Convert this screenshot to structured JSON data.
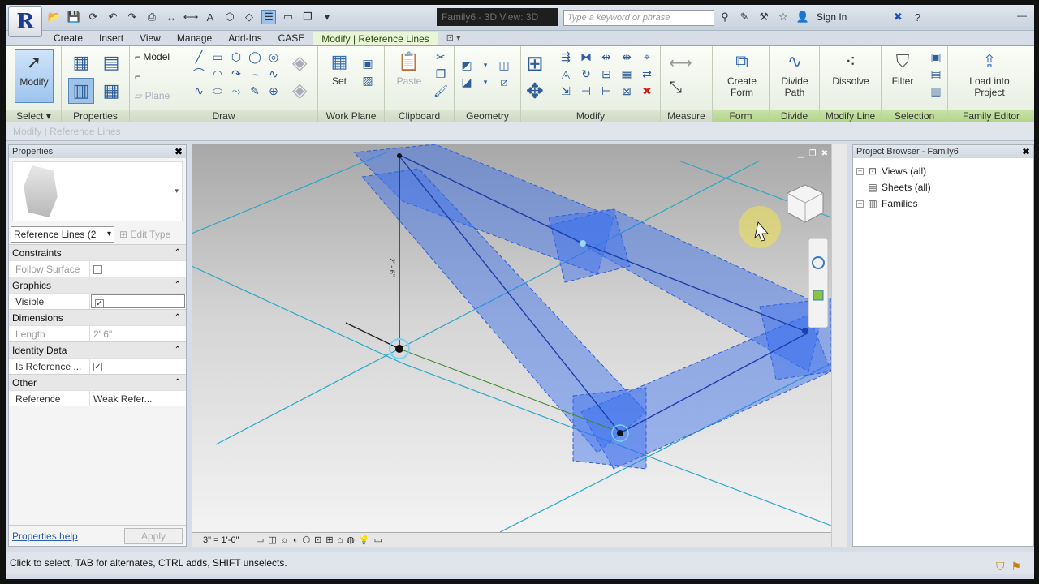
{
  "title_bar": {
    "file_title": "Family6 - 3D View: 3D",
    "search_placeholder": "Type a keyword or phrase",
    "signin_label": "Sign In",
    "help_label": "?"
  },
  "tabs": [
    "Create",
    "Insert",
    "View",
    "Manage",
    "Add-Ins",
    "CASE",
    "Modify | Reference Lines"
  ],
  "ribbon": {
    "modify_label": "Modify",
    "draw_model_label": "Model",
    "draw_plane_label": "Plane",
    "set_label": "Set",
    "paste_label": "Paste",
    "create_form_label": "Create Form",
    "divide_path_label": "Divide Path",
    "dissolve_label": "Dissolve",
    "filter_label": "Filter",
    "load_into_project_label": "Load into Project",
    "panels": {
      "select": "Select ▾",
      "properties": "Properties",
      "draw": "Draw",
      "work_plane": "Work Plane",
      "clipboard": "Clipboard",
      "geometry": "Geometry",
      "modify": "Modify",
      "measure": "Measure",
      "form": "Form",
      "divide": "Divide",
      "modify_line": "Modify Line",
      "selection": "Selection",
      "family_editor": "Family Editor"
    }
  },
  "context_bar": "Modify | Reference Lines",
  "properties": {
    "title": "Properties",
    "type_selector": "Reference Lines (2",
    "edit_type_label": "Edit Type",
    "sections": {
      "constraints": "Constraints",
      "graphics": "Graphics",
      "dimensions": "Dimensions",
      "identity": "Identity Data",
      "other": "Other"
    },
    "rows": {
      "follow_surface": "Follow Surface",
      "visible": "Visible",
      "length": "Length",
      "length_value": "2'  6\"",
      "is_reference": "Is Reference ...",
      "reference": "Reference",
      "reference_value": "Weak Refer..."
    },
    "help_link": "Properties help",
    "apply_label": "Apply"
  },
  "viewport": {
    "scale": "3\" = 1'-0\"",
    "dimension_text": "2' - 6\""
  },
  "project_browser": {
    "title": "Project Browser - Family6",
    "items": [
      "Views (all)",
      "Sheets (all)",
      "Families"
    ]
  },
  "status_bar": "Click to select, TAB for alternates, CTRL adds, SHIFT unselects.",
  "colors": {
    "ribbon_accent": "#9ab27a",
    "selection_blue": "#3a6ef0",
    "workplane_cyan": "#2aa7c9"
  }
}
